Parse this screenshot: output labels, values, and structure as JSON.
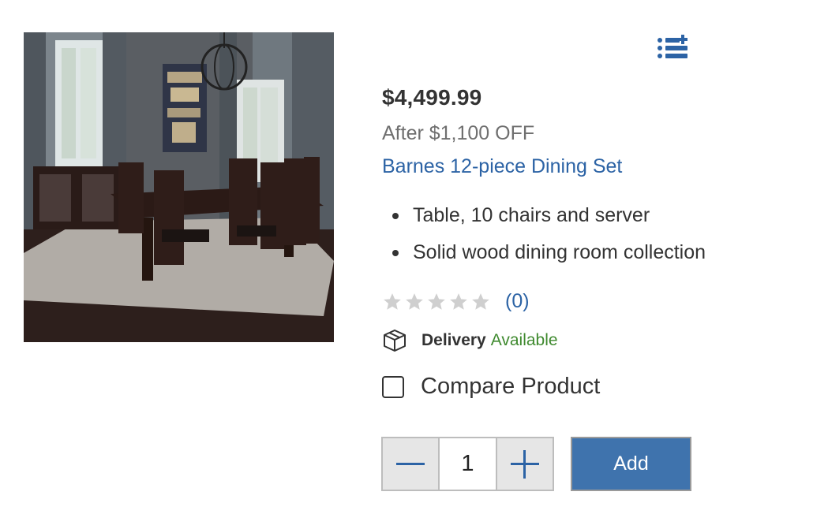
{
  "product": {
    "image_alt": "dining room set photo",
    "price": "$4,499.99",
    "discount": "After $1,100 OFF",
    "title": "Barnes 12-piece Dining Set",
    "features": [
      "Table, 10 chairs and server",
      "Solid wood dining room collection"
    ],
    "rating": {
      "stars_filled": 0,
      "stars_total": 5,
      "count_label": "(0)"
    },
    "delivery": {
      "label": "Delivery",
      "status": "Available"
    }
  },
  "actions": {
    "list_icon": "add-to-list-icon",
    "compare_label": "Compare Product",
    "quantity": "1",
    "add_label": "Add"
  },
  "colors": {
    "link": "#2c63a5",
    "available": "#3f8a2f",
    "add_button": "#3f73ad",
    "star_empty": "#cfcfcf"
  }
}
